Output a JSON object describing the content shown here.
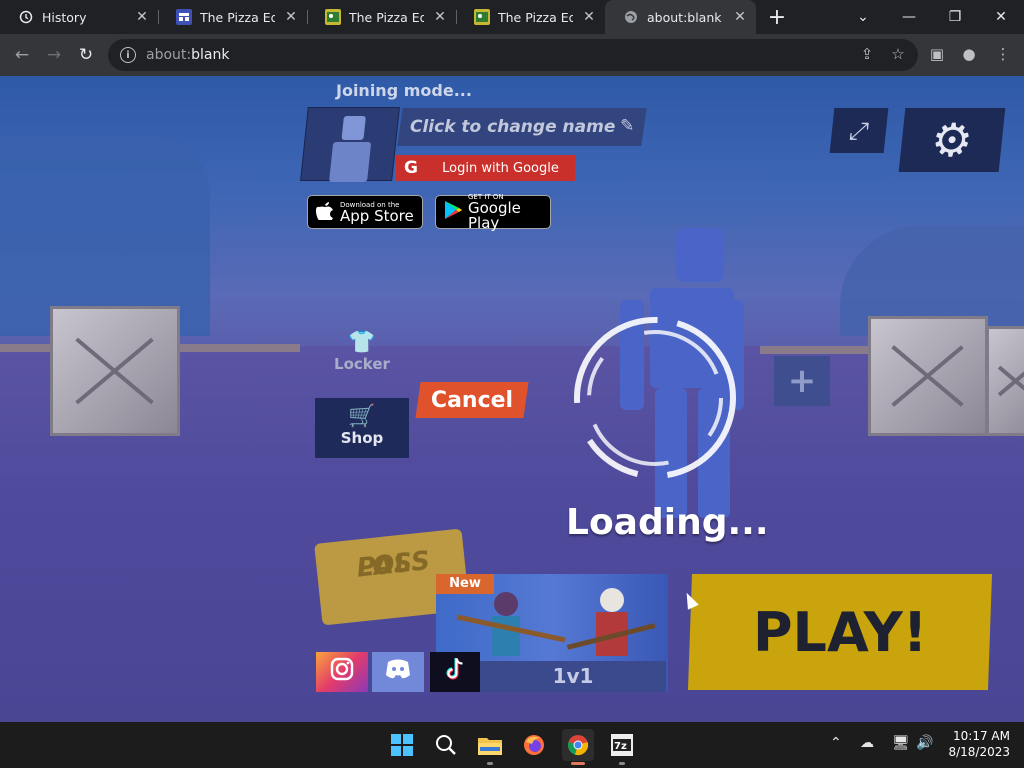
{
  "browser": {
    "tabs": [
      {
        "title": "History",
        "icon": "history-icon",
        "active": false
      },
      {
        "title": "The Pizza Edition",
        "icon": "site-favicon",
        "active": false
      },
      {
        "title": "The Pizza Edition",
        "icon": "site-favicon",
        "active": false
      },
      {
        "title": "The Pizza Edition",
        "icon": "site-favicon",
        "active": false
      },
      {
        "title": "about:blank",
        "icon": "globe-icon",
        "active": true
      }
    ],
    "url_scheme": "about:",
    "url_host": "blank"
  },
  "game": {
    "joining_mode": "Joining mode...",
    "name_placeholder": "Click to change name",
    "google_login": "Login with Google",
    "app_store_small": "Download on the",
    "app_store_big": "App Store",
    "google_play_small": "GET IT ON",
    "google_play_big": "Google Play",
    "locker_label": "Locker",
    "shop_label": "Shop",
    "cancel_label": "Cancel",
    "loading_text": "Loading...",
    "lolpass_line1": "LOL",
    "lolpass_line2": "PASS",
    "new_tag": "New",
    "mode_label": "1v1",
    "play_label": "PLAY!"
  },
  "taskbar": {
    "time": "10:17 AM",
    "date": "8/18/2023"
  },
  "colors": {
    "cancel": "#e0522c",
    "play": "#c9a40d",
    "google": "#c9302c",
    "chrome_dark": "#202124"
  }
}
